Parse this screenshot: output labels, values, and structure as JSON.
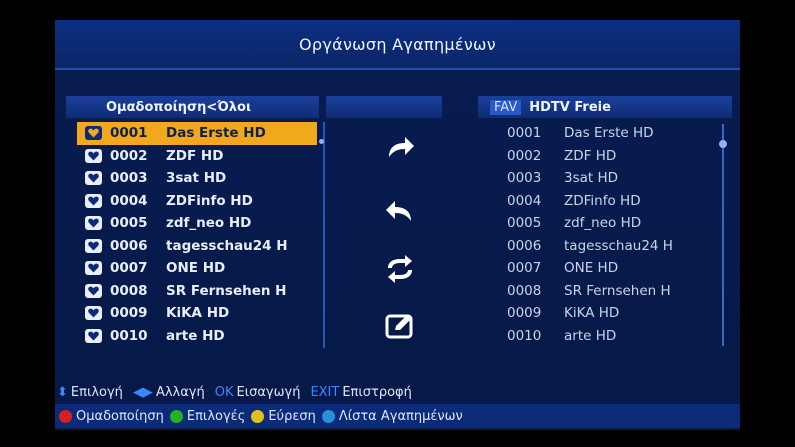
{
  "title": "Οργάνωση Αγαπημένων",
  "left_panel": {
    "header": "Ομαδοποίηση<Όλοι",
    "selected_index": 0,
    "channels": [
      {
        "num": "0001",
        "name": "Das Erste HD"
      },
      {
        "num": "0002",
        "name": "ZDF HD"
      },
      {
        "num": "0003",
        "name": "3sat HD"
      },
      {
        "num": "0004",
        "name": "ZDFinfo HD"
      },
      {
        "num": "0005",
        "name": "zdf_neo HD"
      },
      {
        "num": "0006",
        "name": "tagesschau24 H"
      },
      {
        "num": "0007",
        "name": "ONE HD"
      },
      {
        "num": "0008",
        "name": "SR Fernsehen H"
      },
      {
        "num": "0009",
        "name": "KiKA HD"
      },
      {
        "num": "0010",
        "name": "arte HD"
      }
    ]
  },
  "right_panel": {
    "fav_tag": "FAV",
    "header": "HDTV Freie",
    "channels": [
      {
        "num": "0001",
        "name": "Das Erste HD"
      },
      {
        "num": "0002",
        "name": "ZDF HD"
      },
      {
        "num": "0003",
        "name": "3sat HD"
      },
      {
        "num": "0004",
        "name": "ZDFinfo HD"
      },
      {
        "num": "0005",
        "name": "zdf_neo HD"
      },
      {
        "num": "0006",
        "name": "tagesschau24 H"
      },
      {
        "num": "0007",
        "name": "ONE HD"
      },
      {
        "num": "0008",
        "name": "SR Fernsehen H"
      },
      {
        "num": "0009",
        "name": "KiKA HD"
      },
      {
        "num": "0010",
        "name": "arte HD"
      }
    ]
  },
  "actions": [
    {
      "icon": "forward-arrow-icon"
    },
    {
      "icon": "back-arrow-icon"
    },
    {
      "icon": "swap-arrows-icon"
    },
    {
      "icon": "edit-icon"
    }
  ],
  "help_bar": {
    "select": {
      "key": "⬍",
      "label": "Επιλογή"
    },
    "change": {
      "key": "◀▶",
      "label": "Αλλαγή"
    },
    "insert": {
      "key": "OK",
      "label": "Εισαγωγή"
    },
    "back": {
      "key": "EXIT",
      "label": "Επιστροφή"
    }
  },
  "color_bar": {
    "red": "Ομαδοποίηση",
    "green": "Επιλογές",
    "yellow": "Εύρεση",
    "blue": "Λίστα Αγαπημένων"
  },
  "colors": {
    "selection": "#f2a81d",
    "red_button": "#d82020",
    "green_button": "#28b028",
    "yellow_button": "#e0c020",
    "blue_button": "#2a8fd8"
  }
}
